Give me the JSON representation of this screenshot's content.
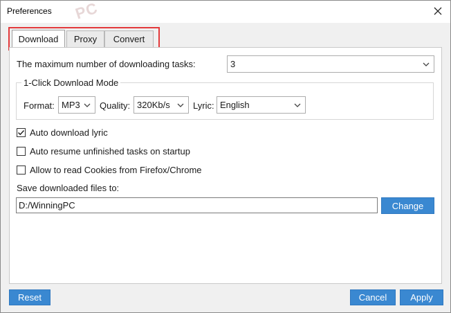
{
  "window": {
    "title": "Preferences",
    "watermark": "PC"
  },
  "tabs": [
    {
      "label": "Download",
      "active": true
    },
    {
      "label": "Proxy",
      "active": false
    },
    {
      "label": "Convert",
      "active": false
    }
  ],
  "download": {
    "max_tasks_label": "The maximum number of downloading tasks:",
    "max_tasks_value": "3",
    "group_title": "1-Click Download Mode",
    "format_label": "Format:",
    "format_value": "MP3",
    "quality_label": "Quality:",
    "quality_value": "320Kb/s",
    "lyric_label": "Lyric:",
    "lyric_value": "English",
    "auto_lyric_label": "Auto download lyric",
    "auto_lyric_checked": true,
    "auto_resume_label": "Auto resume unfinished tasks on startup",
    "auto_resume_checked": false,
    "cookies_label": "Allow to read Cookies from Firefox/Chrome",
    "cookies_checked": false,
    "save_label": "Save downloaded files to:",
    "save_path": "D:/WinningPC",
    "change_label": "Change"
  },
  "footer": {
    "reset_label": "Reset",
    "cancel_label": "Cancel",
    "apply_label": "Apply"
  },
  "colors": {
    "accent": "#3a88d1",
    "highlight": "#e3393b"
  }
}
